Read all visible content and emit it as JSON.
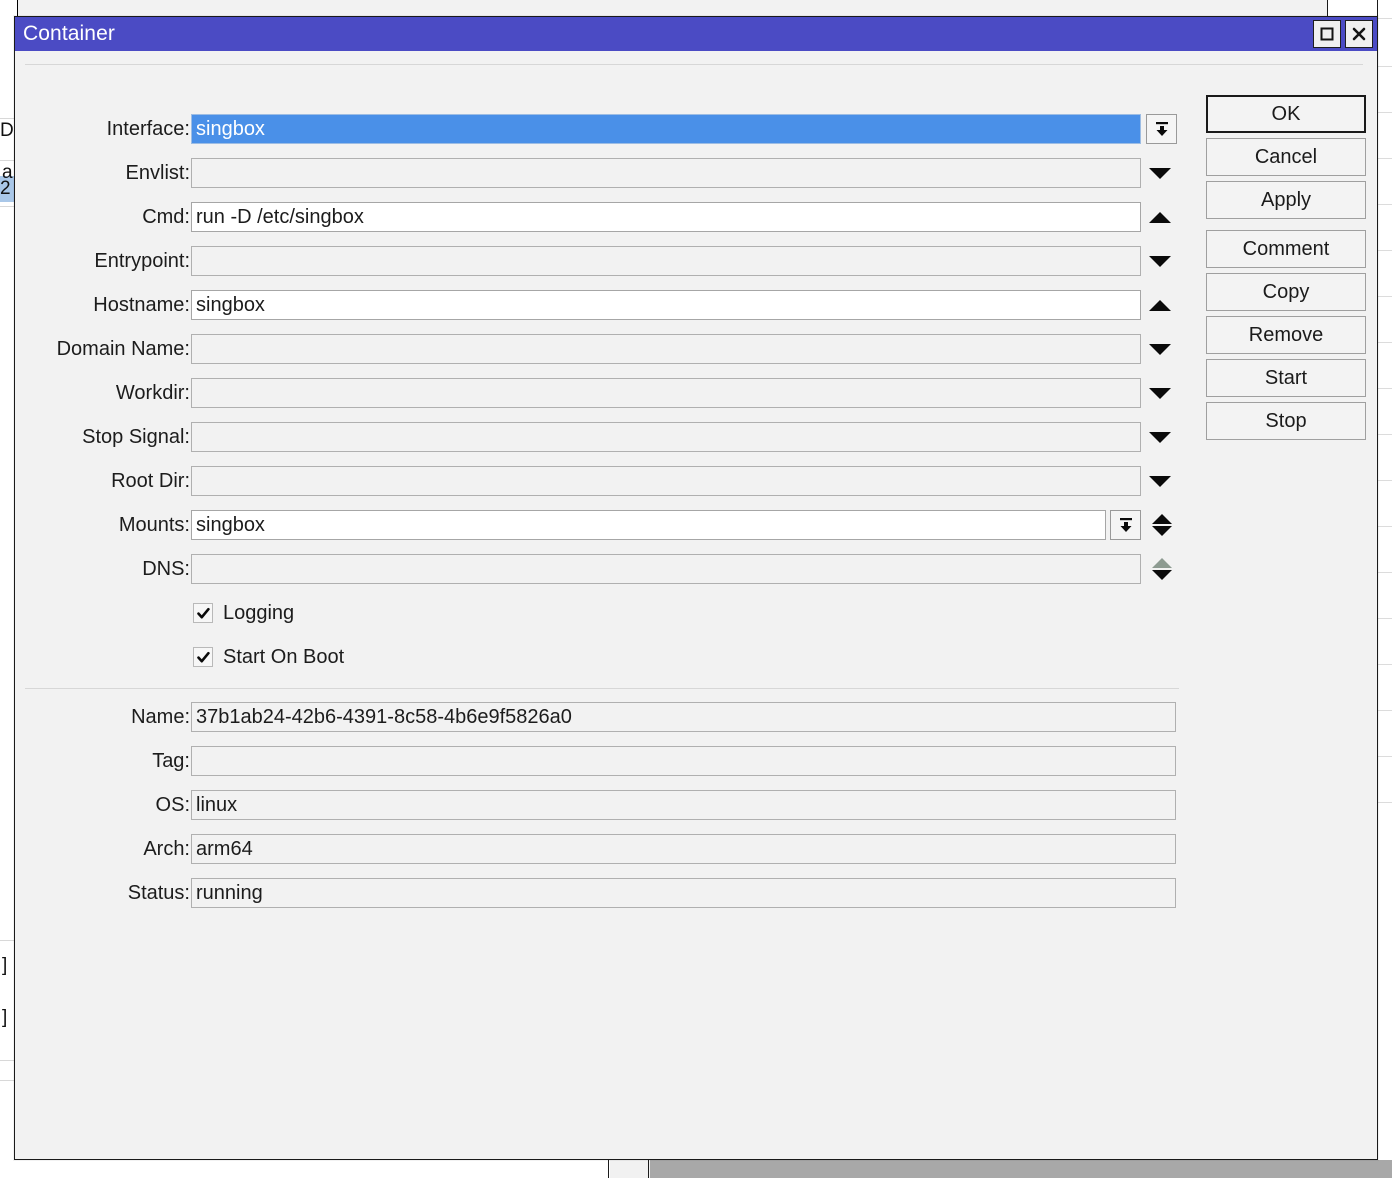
{
  "window": {
    "title": "Container",
    "maximize_icon": "maximize-icon",
    "close_icon": "close-icon"
  },
  "form": {
    "top_fields": [
      {
        "label": "Interface:",
        "value": "singbox",
        "state": "selected",
        "control": "dropdown-button"
      },
      {
        "label": "Envlist:",
        "value": "",
        "state": "readonly",
        "control": "arrow-down"
      },
      {
        "label": "Cmd:",
        "value": "run -D /etc/singbox",
        "state": "editable",
        "control": "arrow-up"
      },
      {
        "label": "Entrypoint:",
        "value": "",
        "state": "readonly",
        "control": "arrow-down"
      },
      {
        "label": "Hostname:",
        "value": "singbox",
        "state": "editable",
        "control": "arrow-up"
      },
      {
        "label": "Domain Name:",
        "value": "",
        "state": "readonly",
        "control": "arrow-down"
      },
      {
        "label": "Workdir:",
        "value": "",
        "state": "readonly",
        "control": "arrow-down"
      },
      {
        "label": "Stop Signal:",
        "value": "",
        "state": "readonly",
        "control": "arrow-down"
      },
      {
        "label": "Root Dir:",
        "value": "",
        "state": "readonly",
        "control": "arrow-down"
      },
      {
        "label": "Mounts:",
        "value": "singbox",
        "state": "editable",
        "control": "dropdown-spinner"
      },
      {
        "label": "DNS:",
        "value": "",
        "state": "readonly",
        "control": "spinner-dim-up"
      }
    ],
    "checkboxes": [
      {
        "label": "Logging",
        "checked": true
      },
      {
        "label": "Start On Boot",
        "checked": true
      }
    ],
    "bottom_fields": [
      {
        "label": "Name:",
        "value": "37b1ab24-42b6-4391-8c58-4b6e9f5826a0"
      },
      {
        "label": "Tag:",
        "value": ""
      },
      {
        "label": "OS:",
        "value": "linux"
      },
      {
        "label": "Arch:",
        "value": "arm64"
      },
      {
        "label": "Status:",
        "value": "running"
      }
    ]
  },
  "buttons": [
    {
      "label": "OK",
      "default": true
    },
    {
      "label": "Cancel",
      "default": false
    },
    {
      "label": "Apply",
      "default": false
    },
    {
      "label": "Comment",
      "default": false
    },
    {
      "label": "Copy",
      "default": false
    },
    {
      "label": "Remove",
      "default": false
    },
    {
      "label": "Start",
      "default": false
    },
    {
      "label": "Stop",
      "default": false
    }
  ],
  "colors": {
    "titlebar": "#4b4bc4",
    "selection": "#4a90e8",
    "window_bg": "#f2f2f2",
    "field_border": "#b0b0b0",
    "text": "#1c1c1c"
  }
}
